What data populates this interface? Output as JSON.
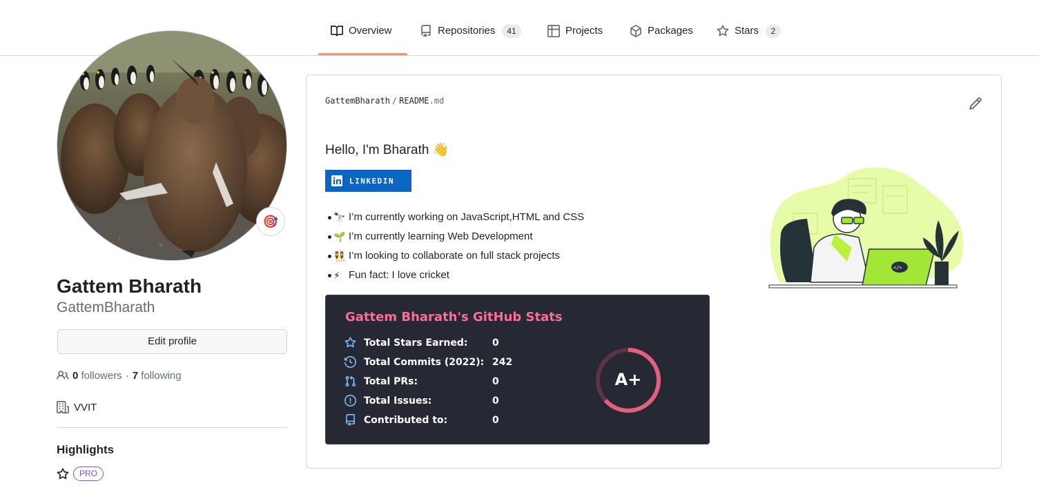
{
  "tabs": [
    {
      "label": "Overview",
      "icon": "book-icon",
      "counter": null,
      "selected": true
    },
    {
      "label": "Repositories",
      "icon": "repo-icon",
      "counter": "41",
      "selected": false
    },
    {
      "label": "Projects",
      "icon": "table-icon",
      "counter": null,
      "selected": false
    },
    {
      "label": "Packages",
      "icon": "package-icon",
      "counter": null,
      "selected": false
    },
    {
      "label": "Stars",
      "icon": "star-icon",
      "counter": "2",
      "selected": false
    }
  ],
  "profile": {
    "full_name": "Gattem Bharath",
    "username": "GattemBharath",
    "status_emoji": "🎯",
    "edit_label": "Edit profile",
    "followers_count": "0",
    "followers_label": "followers",
    "following_count": "7",
    "following_label": "following",
    "separator": "·",
    "organization": "VVIT",
    "highlights_title": "Highlights",
    "pro_badge": "PRO"
  },
  "readme": {
    "owner": "GattemBharath",
    "sep": "/",
    "file": "README",
    "ext": ".md",
    "greeting": "Hello, I'm Bharath 👋",
    "linkedin_label": "LINKEDIN",
    "bullets": [
      {
        "emoji": "🔭",
        "text": "I’m currently working on JavaScript,HTML and CSS"
      },
      {
        "emoji": "🌱",
        "text": "I’m currently learning Web Development"
      },
      {
        "emoji": "👯",
        "text": "I’m looking to collaborate on full stack projects"
      },
      {
        "emoji": "⚡",
        "text": "Fun fact: I love cricket"
      }
    ]
  },
  "stats": {
    "title": "Gattem Bharath's GitHub Stats",
    "rows": [
      {
        "icon": "star-icon",
        "label": "Total Stars Earned:",
        "value": "0"
      },
      {
        "icon": "history-icon",
        "label": "Total Commits (2022):",
        "value": "242"
      },
      {
        "icon": "pull-request-icon",
        "label": "Total PRs:",
        "value": "0"
      },
      {
        "icon": "issue-icon",
        "label": "Total Issues:",
        "value": "0"
      },
      {
        "icon": "repo-icon",
        "label": "Contributed to:",
        "value": "0"
      }
    ],
    "grade": "A+",
    "colors": {
      "title": "#fe6c9a",
      "icons": "#79c0ff",
      "bg": "#262933",
      "ring": "#e4607f"
    }
  },
  "colors": {
    "accent_underline": "#fd8c73",
    "pro": "#8250df",
    "linkedin": "#0a66c2"
  }
}
